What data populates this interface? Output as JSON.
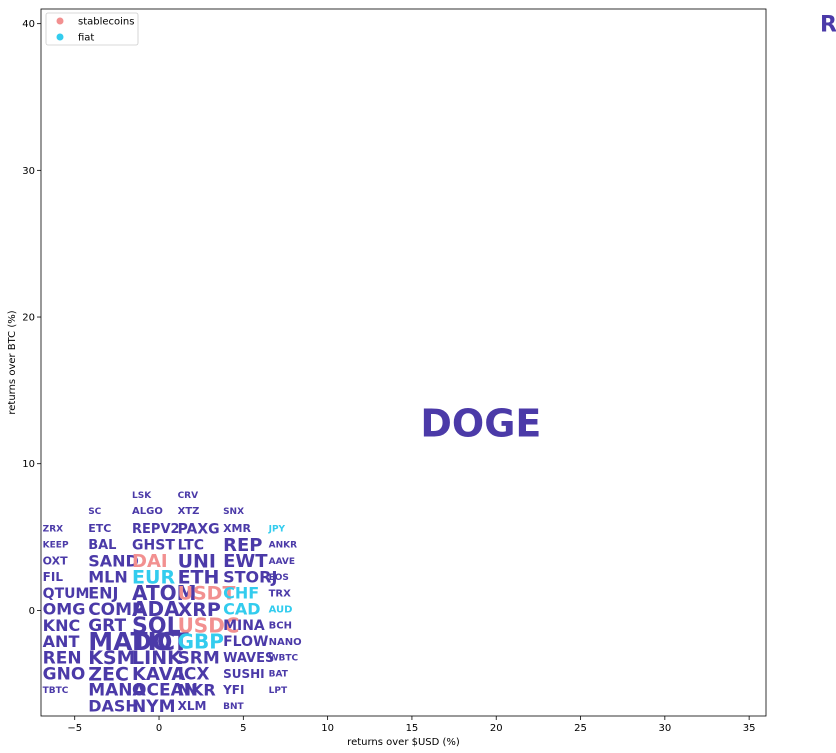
{
  "chart_data": {
    "type": "scatter",
    "xlabel": "returns over $USD (%)",
    "ylabel": "returns over BTC (%)",
    "xlim": [
      -7,
      36
    ],
    "ylim": [
      -7.2,
      41
    ],
    "xticks": [
      -5,
      0,
      5,
      10,
      15,
      20,
      25,
      30,
      35
    ],
    "yticks": [
      0,
      10,
      20,
      30,
      40
    ],
    "grid": false,
    "legend_position": "top-left",
    "colors": {
      "coin": "#4b3aa8",
      "stablecoins": "#f29090",
      "fiat": "#33ccee"
    },
    "legend": [
      {
        "key": "stablecoins",
        "label": "stablecoins"
      },
      {
        "key": "fiat",
        "label": "fiat"
      }
    ],
    "points": [
      {
        "label": "RARI",
        "x": 39.2,
        "y": 40.0,
        "size": 22,
        "group": "coin"
      },
      {
        "label": "DOGE",
        "x": 15.5,
        "y": 12.8,
        "size": 38,
        "group": "coin"
      },
      {
        "label": "LSK",
        "x": -1.6,
        "y": 7.9,
        "size": 9,
        "group": "coin"
      },
      {
        "label": "CRV",
        "x": 1.1,
        "y": 7.9,
        "size": 9,
        "group": "coin"
      },
      {
        "label": "SC",
        "x": -4.2,
        "y": 6.8,
        "size": 9,
        "group": "coin"
      },
      {
        "label": "ALGO",
        "x": -1.6,
        "y": 6.8,
        "size": 10,
        "group": "coin"
      },
      {
        "label": "XTZ",
        "x": 1.1,
        "y": 6.8,
        "size": 10,
        "group": "coin"
      },
      {
        "label": "SNX",
        "x": 3.8,
        "y": 6.8,
        "size": 9,
        "group": "coin"
      },
      {
        "label": "ZRX",
        "x": -6.9,
        "y": 5.6,
        "size": 9,
        "group": "coin"
      },
      {
        "label": "ETC",
        "x": -4.2,
        "y": 5.6,
        "size": 11,
        "group": "coin"
      },
      {
        "label": "REPV2",
        "x": -1.6,
        "y": 5.6,
        "size": 13,
        "group": "coin"
      },
      {
        "label": "PAXG",
        "x": 1.1,
        "y": 5.6,
        "size": 14,
        "group": "coin"
      },
      {
        "label": "XMR",
        "x": 3.8,
        "y": 5.6,
        "size": 11,
        "group": "coin"
      },
      {
        "label": "JPY",
        "x": 6.5,
        "y": 5.6,
        "size": 9,
        "group": "fiat"
      },
      {
        "label": "KEEP",
        "x": -6.9,
        "y": 4.5,
        "size": 9,
        "group": "coin"
      },
      {
        "label": "BAL",
        "x": -4.2,
        "y": 4.5,
        "size": 13,
        "group": "coin"
      },
      {
        "label": "GHST",
        "x": -1.6,
        "y": 4.5,
        "size": 14,
        "group": "coin"
      },
      {
        "label": "LTC",
        "x": 1.1,
        "y": 4.5,
        "size": 14,
        "group": "coin"
      },
      {
        "label": "REP",
        "x": 3.8,
        "y": 4.5,
        "size": 18,
        "group": "coin"
      },
      {
        "label": "ANKR",
        "x": 6.5,
        "y": 4.5,
        "size": 9,
        "group": "coin"
      },
      {
        "label": "OXT",
        "x": -6.9,
        "y": 3.4,
        "size": 11,
        "group": "coin"
      },
      {
        "label": "SAND",
        "x": -4.2,
        "y": 3.4,
        "size": 16,
        "group": "coin"
      },
      {
        "label": "DAI",
        "x": -1.6,
        "y": 3.4,
        "size": 18,
        "group": "stablecoins"
      },
      {
        "label": "UNI",
        "x": 1.1,
        "y": 3.4,
        "size": 19,
        "group": "coin"
      },
      {
        "label": "EWT",
        "x": 3.8,
        "y": 3.4,
        "size": 18,
        "group": "coin"
      },
      {
        "label": "AAVE",
        "x": 6.5,
        "y": 3.4,
        "size": 9,
        "group": "coin"
      },
      {
        "label": "FIL",
        "x": -6.9,
        "y": 2.3,
        "size": 12,
        "group": "coin"
      },
      {
        "label": "MLN",
        "x": -4.2,
        "y": 2.3,
        "size": 16,
        "group": "coin"
      },
      {
        "label": "EUR",
        "x": -1.6,
        "y": 2.3,
        "size": 19,
        "group": "fiat"
      },
      {
        "label": "ETH",
        "x": 1.1,
        "y": 2.3,
        "size": 19,
        "group": "coin"
      },
      {
        "label": "STORJ",
        "x": 3.8,
        "y": 2.3,
        "size": 16,
        "group": "coin"
      },
      {
        "label": "EOS",
        "x": 6.5,
        "y": 2.3,
        "size": 9,
        "group": "coin"
      },
      {
        "label": "QTUM",
        "x": -6.9,
        "y": 1.2,
        "size": 14,
        "group": "coin"
      },
      {
        "label": "ENJ",
        "x": -4.2,
        "y": 1.2,
        "size": 16,
        "group": "coin"
      },
      {
        "label": "ATOM",
        "x": -1.6,
        "y": 1.2,
        "size": 20,
        "group": "coin"
      },
      {
        "label": "USDT",
        "x": 1.1,
        "y": 1.2,
        "size": 19,
        "group": "stablecoins"
      },
      {
        "label": "CHF",
        "x": 3.8,
        "y": 1.2,
        "size": 16,
        "group": "fiat"
      },
      {
        "label": "TRX",
        "x": 6.5,
        "y": 1.2,
        "size": 10,
        "group": "coin"
      },
      {
        "label": "OMG",
        "x": -6.9,
        "y": 0.1,
        "size": 16,
        "group": "coin"
      },
      {
        "label": "COMP",
        "x": -4.2,
        "y": 0.1,
        "size": 17,
        "group": "coin"
      },
      {
        "label": "ADA",
        "x": -1.6,
        "y": 0.1,
        "size": 20,
        "group": "coin"
      },
      {
        "label": "XRP",
        "x": 1.1,
        "y": 0.1,
        "size": 19,
        "group": "coin"
      },
      {
        "label": "CAD",
        "x": 3.8,
        "y": 0.1,
        "size": 16,
        "group": "fiat"
      },
      {
        "label": "AUD",
        "x": 6.5,
        "y": 0.1,
        "size": 10,
        "group": "fiat"
      },
      {
        "label": "KNC",
        "x": -6.9,
        "y": -1.0,
        "size": 16,
        "group": "coin"
      },
      {
        "label": "GRT",
        "x": -4.2,
        "y": -1.0,
        "size": 17,
        "group": "coin"
      },
      {
        "label": "SOL",
        "x": -1.6,
        "y": -1.0,
        "size": 22,
        "group": "coin"
      },
      {
        "label": "USDC",
        "x": 1.1,
        "y": -1.0,
        "size": 20,
        "group": "stablecoins"
      },
      {
        "label": "MINA",
        "x": 3.8,
        "y": -1.0,
        "size": 14,
        "group": "coin"
      },
      {
        "label": "BCH",
        "x": 6.5,
        "y": -1.0,
        "size": 10,
        "group": "coin"
      },
      {
        "label": "ANT",
        "x": -6.9,
        "y": -2.1,
        "size": 16,
        "group": "coin"
      },
      {
        "label": "MATIC",
        "x": -4.2,
        "y": -2.1,
        "size": 25,
        "group": "coin"
      },
      {
        "label": "DOT",
        "x": -1.6,
        "y": -2.1,
        "size": 24,
        "group": "coin"
      },
      {
        "label": "GBP",
        "x": 1.1,
        "y": -2.1,
        "size": 20,
        "group": "fiat"
      },
      {
        "label": "FLOW",
        "x": 3.8,
        "y": -2.1,
        "size": 14,
        "group": "coin"
      },
      {
        "label": "NANO",
        "x": 6.5,
        "y": -2.1,
        "size": 10,
        "group": "coin"
      },
      {
        "label": "REN",
        "x": -6.9,
        "y": -3.2,
        "size": 17,
        "group": "coin"
      },
      {
        "label": "KSM",
        "x": -4.2,
        "y": -3.2,
        "size": 19,
        "group": "coin"
      },
      {
        "label": "LINK",
        "x": -1.6,
        "y": -3.2,
        "size": 19,
        "group": "coin"
      },
      {
        "label": "SRM",
        "x": 1.1,
        "y": -3.2,
        "size": 17,
        "group": "coin"
      },
      {
        "label": "WAVES",
        "x": 3.8,
        "y": -3.2,
        "size": 13,
        "group": "coin"
      },
      {
        "label": "WBTC",
        "x": 6.5,
        "y": -3.2,
        "size": 9,
        "group": "coin"
      },
      {
        "label": "GNO",
        "x": -6.9,
        "y": -4.3,
        "size": 17,
        "group": "coin"
      },
      {
        "label": "ZEC",
        "x": -4.2,
        "y": -4.3,
        "size": 19,
        "group": "coin"
      },
      {
        "label": "KAVA",
        "x": -1.6,
        "y": -4.3,
        "size": 18,
        "group": "coin"
      },
      {
        "label": "ICX",
        "x": 1.1,
        "y": -4.3,
        "size": 17,
        "group": "coin"
      },
      {
        "label": "SUSHI",
        "x": 3.8,
        "y": -4.3,
        "size": 12,
        "group": "coin"
      },
      {
        "label": "BAT",
        "x": 6.5,
        "y": -4.3,
        "size": 9,
        "group": "coin"
      },
      {
        "label": "TBTC",
        "x": -6.9,
        "y": -5.4,
        "size": 9,
        "group": "coin"
      },
      {
        "label": "MANA",
        "x": -4.2,
        "y": -5.4,
        "size": 17,
        "group": "coin"
      },
      {
        "label": "OCEAN",
        "x": -1.6,
        "y": -5.4,
        "size": 17,
        "group": "coin"
      },
      {
        "label": "NKR",
        "x": 1.1,
        "y": -5.4,
        "size": 16,
        "group": "coin"
      },
      {
        "label": "YFI",
        "x": 3.8,
        "y": -5.4,
        "size": 12,
        "group": "coin"
      },
      {
        "label": "LPT",
        "x": 6.5,
        "y": -5.4,
        "size": 9,
        "group": "coin"
      },
      {
        "label": "DASH",
        "x": -4.2,
        "y": -6.5,
        "size": 16,
        "group": "coin"
      },
      {
        "label": "NYM",
        "x": -1.6,
        "y": -6.5,
        "size": 17,
        "group": "coin"
      },
      {
        "label": "XLM",
        "x": 1.1,
        "y": -6.5,
        "size": 12,
        "group": "coin"
      },
      {
        "label": "BNT",
        "x": 3.8,
        "y": -6.5,
        "size": 9,
        "group": "coin"
      }
    ]
  }
}
